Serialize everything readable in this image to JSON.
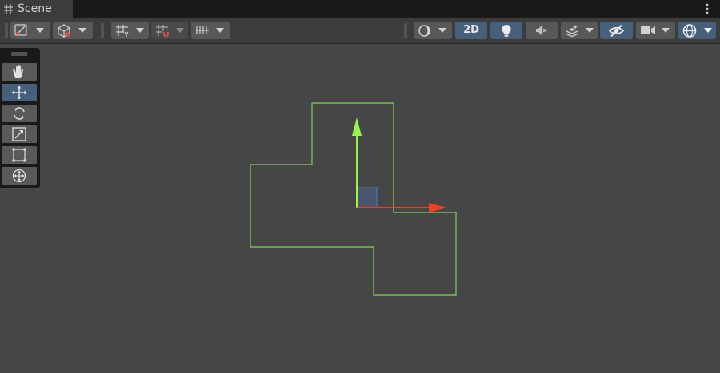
{
  "window": {
    "tab_title": "Scene",
    "tab_icon": "grid-hash-icon",
    "menu_icon": "kebab-menu-icon"
  },
  "toolbar": {
    "left_groups": [
      {
        "name": "draw-mode-dropdown",
        "icon": "draw-mode-icon"
      },
      {
        "name": "gizmo-pivot-dropdown",
        "icon": "cube-pivot-icon"
      },
      {
        "name": "grid-snap-dropdown",
        "icon": "grid-y-icon"
      },
      {
        "name": "increment-snap-dropdown",
        "icon": "grid-magnet-icon"
      },
      {
        "name": "snap-increment-dropdown",
        "icon": "ruler-ticks-icon"
      }
    ],
    "right_buttons": {
      "shading": "shading-sphere-icon",
      "mode_2d_label": "2D",
      "lighting": "lightbulb-icon",
      "audio": "speaker-muted-icon",
      "effects": "layers-sparkle-icon",
      "visibility": "eye-slash-icon",
      "camera": "camera-icon",
      "gizmos": "gizmo-globe-icon"
    },
    "active": [
      "2D",
      "lighting",
      "visibility",
      "gizmos"
    ]
  },
  "tools_overlay": {
    "active_tool": "move",
    "items": [
      {
        "name": "hand",
        "icon": "hand-icon"
      },
      {
        "name": "move",
        "icon": "move-arrows-icon"
      },
      {
        "name": "rotate",
        "icon": "rotate-icon"
      },
      {
        "name": "scale",
        "icon": "scale-icon"
      },
      {
        "name": "rect",
        "icon": "rect-transform-icon"
      },
      {
        "name": "transform",
        "icon": "transform-icon"
      }
    ]
  },
  "scene": {
    "colors": {
      "background": "#464646",
      "collider_outline": "#7fd35a",
      "y_axis": "#9bf249",
      "x_axis": "#f0401e",
      "plane_handle": "#4a6ea8"
    }
  }
}
